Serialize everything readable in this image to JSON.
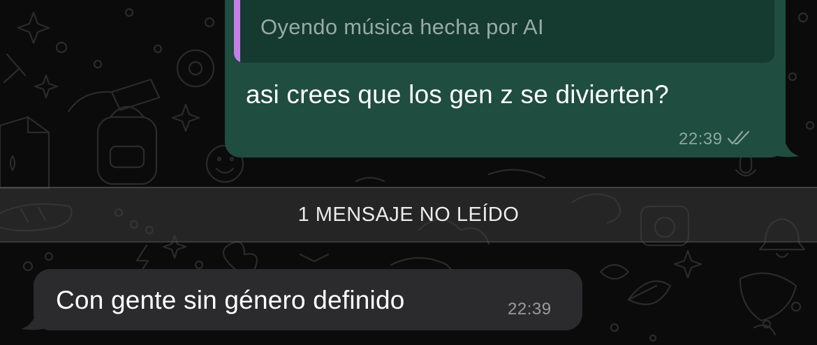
{
  "colors": {
    "chat_background": "#0b0b0b",
    "outgoing_bubble": "#1f4d3f",
    "quote_background": "#153a30",
    "quote_accent": "#c77fe8",
    "incoming_bubble": "#2b2b2d",
    "unread_banner": "#3c3c3c"
  },
  "outgoing_message": {
    "quoted_text": "Oyendo música hecha por AI",
    "text": "asi crees que los gen z se divierten?",
    "time": "22:39",
    "status_icon": "double-check-read-icon"
  },
  "unread_divider": {
    "label": "1 MENSAJE NO LEÍDO"
  },
  "incoming_message": {
    "text": "Con gente sin género definido",
    "time": "22:39"
  },
  "background_pattern": "doodle-wallpaper"
}
